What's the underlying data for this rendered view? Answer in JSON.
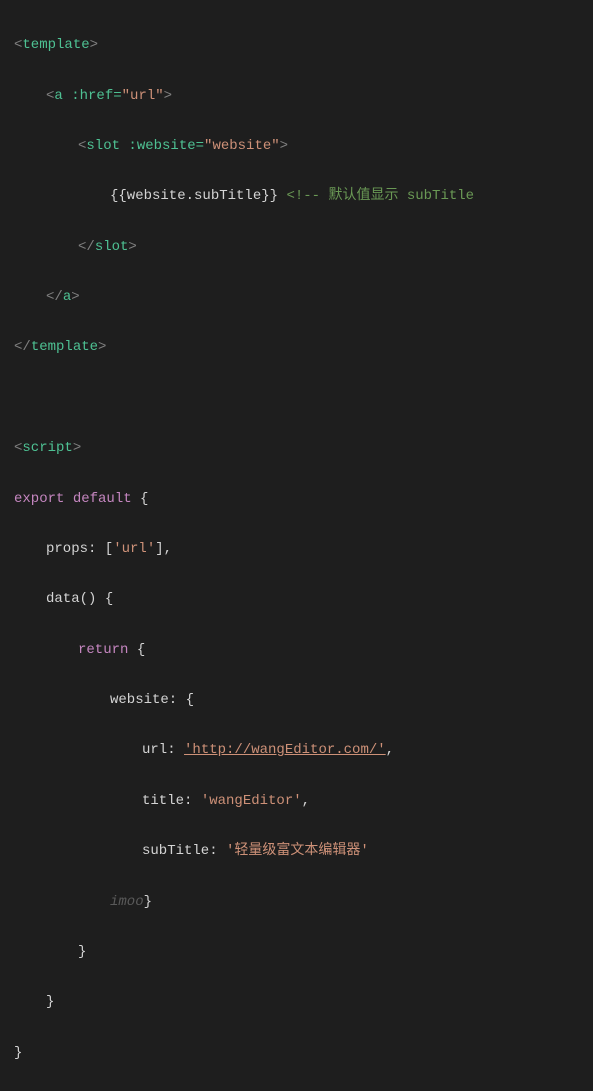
{
  "code": {
    "l1": {
      "open": "<",
      "tag": "template",
      "close": ">"
    },
    "l2": {
      "open": "<",
      "tag": "a",
      "attr": ":href",
      "eq": "=",
      "q1": "\"",
      "val": "url",
      "q2": "\"",
      "close": ">"
    },
    "l3": {
      "open": "<",
      "tag": "slot",
      "attr": ":website",
      "eq": "=",
      "q1": "\"",
      "val": "website",
      "q2": "\"",
      "close": ">"
    },
    "l4": {
      "mustache": "{{website.subTitle}}",
      "comment": "<!-- 默认值显示 subTitle"
    },
    "l5": {
      "open": "</",
      "tag": "slot",
      "close": ">"
    },
    "l6": {
      "open": "</",
      "tag": "a",
      "close": ">"
    },
    "l7": {
      "open": "</",
      "tag": "template",
      "close": ">"
    },
    "l8": "",
    "l9": {
      "open": "<",
      "tag": "script",
      "close": ">"
    },
    "l10": {
      "kw1": "export",
      "kw2": "default",
      "brace": " {"
    },
    "l11": {
      "prop": "props:",
      "val": " ['url'],",
      "str": "'url'"
    },
    "l12": {
      "fn": "data()",
      "brace": " {"
    },
    "l13": {
      "kw": "return",
      "brace": " {"
    },
    "l14": {
      "prop": "website:",
      "brace": " {"
    },
    "l15": {
      "prop": "url:",
      "val": " 'http://wangEditor.com/',"
    },
    "l16": {
      "prop": "title:",
      "val": " 'wangEditor',"
    },
    "l17": {
      "prop": "subTitle:",
      "val": " '轻量级富文本编辑器'"
    },
    "l18": {
      "ghost": "imoo",
      "brace": "}"
    },
    "l19": {
      "brace": "}"
    },
    "l20": {
      "brace": "}"
    },
    "l21": {
      "brace": "}"
    }
  }
}
